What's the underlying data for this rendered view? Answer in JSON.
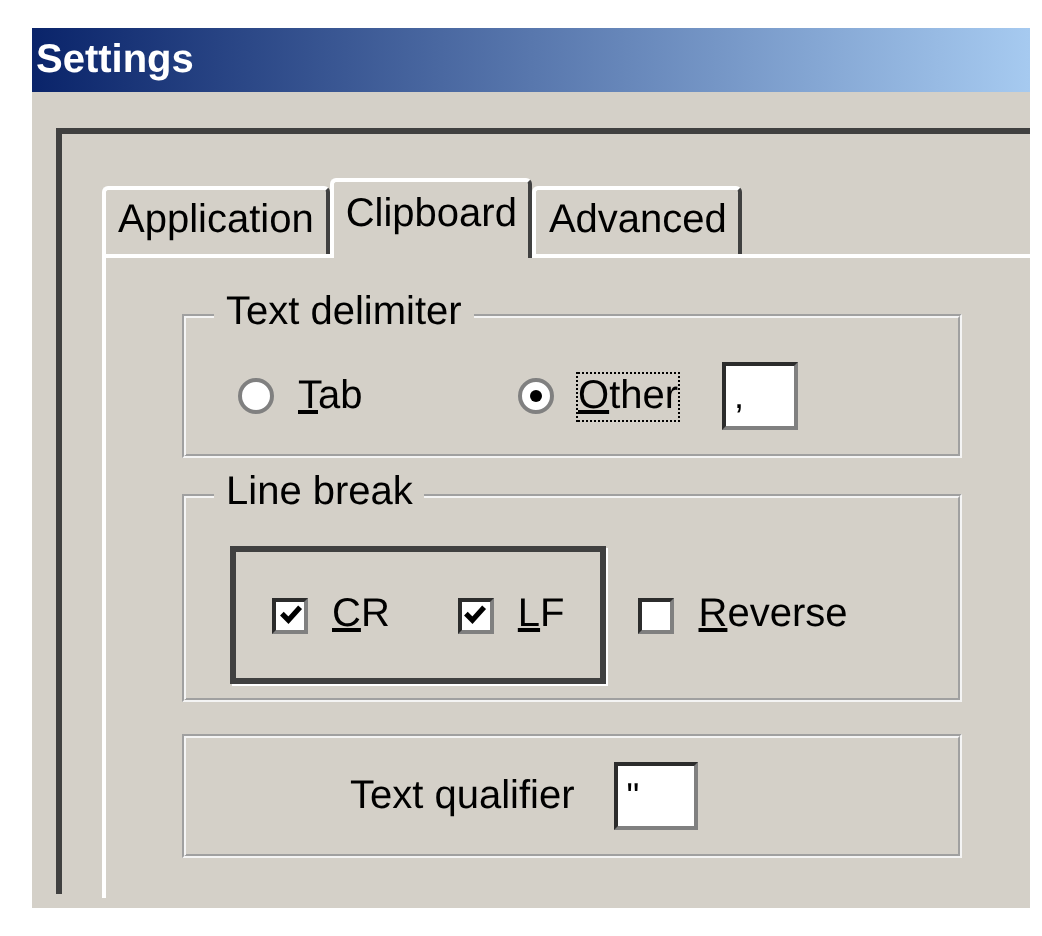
{
  "window": {
    "title": "Settings"
  },
  "tabs": [
    {
      "label": "Application",
      "selected": false
    },
    {
      "label": "Clipboard",
      "selected": true
    },
    {
      "label": "Advanced",
      "selected": false
    }
  ],
  "text_delimiter": {
    "title": "Text delimiter",
    "options": [
      {
        "label": "Tab",
        "selected": false
      },
      {
        "label": "Other",
        "selected": true
      }
    ],
    "other_value": ","
  },
  "line_break": {
    "title": "Line break",
    "options": [
      {
        "label": "CR",
        "checked": true
      },
      {
        "label": "LF",
        "checked": true
      },
      {
        "label": "Reverse",
        "checked": false
      }
    ]
  },
  "text_qualifier": {
    "label": "Text qualifier",
    "value": "\""
  }
}
